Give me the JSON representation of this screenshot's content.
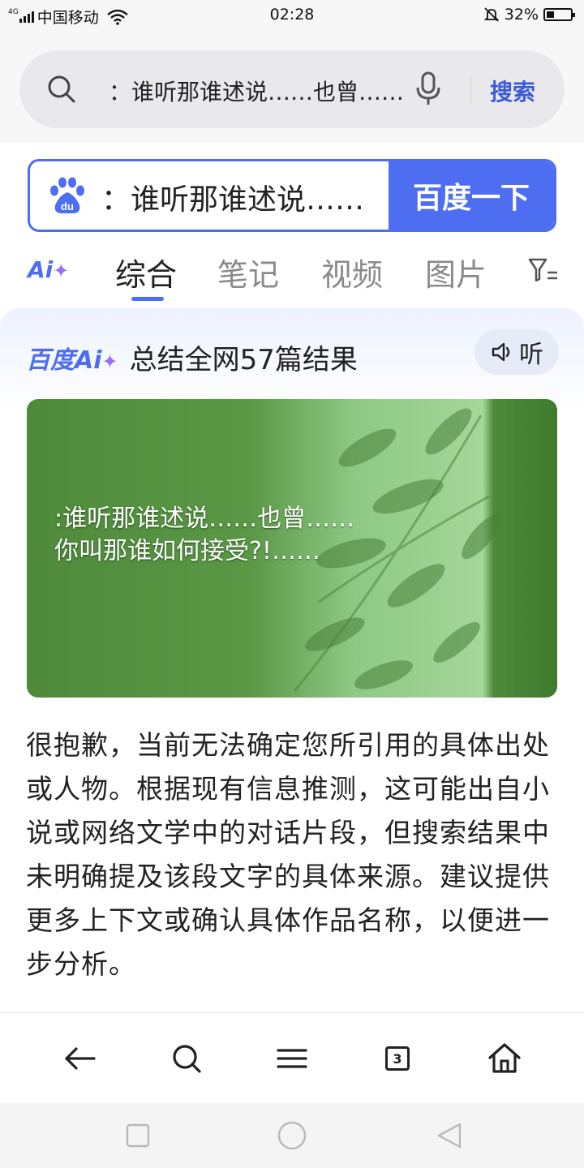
{
  "status_bar": {
    "network": "4G",
    "carrier": "中国移动",
    "time": "02:28",
    "battery": "32%",
    "battery_level": 0.32
  },
  "browser": {
    "search_query": "：谁听那谁述说……也曾……",
    "search_button": "搜索",
    "open_tabs": "3"
  },
  "baidu": {
    "query": "：谁听那谁述说……",
    "submit_label": "百度一下",
    "logo_text": "du",
    "tabs": [
      {
        "label": "综合",
        "active": true
      },
      {
        "label": "笔记",
        "active": false
      },
      {
        "label": "视频",
        "active": false
      },
      {
        "label": "图片",
        "active": false
      }
    ],
    "ai_tab": "Ai"
  },
  "ai_card": {
    "brand": "百度Ai",
    "summary": "总结全网57篇结果",
    "listen_label": "听",
    "image_text": ":谁听那谁述说……也曾……你叫那谁如何接受?!……",
    "answer": "很抱歉，当前无法确定您所引用的具体出处或人物。根据现有信息推测，这可能出自小说或网络文学中的对话片段，但搜索结果中未明确提及该段文字的具体来源。建议提供更多上下文或确认具体作品名称，以便进一步分析。"
  },
  "colors": {
    "accent": "#4e6ef2",
    "ai_purple": "#9b6ef2",
    "image_green": "#4f8d3b"
  }
}
